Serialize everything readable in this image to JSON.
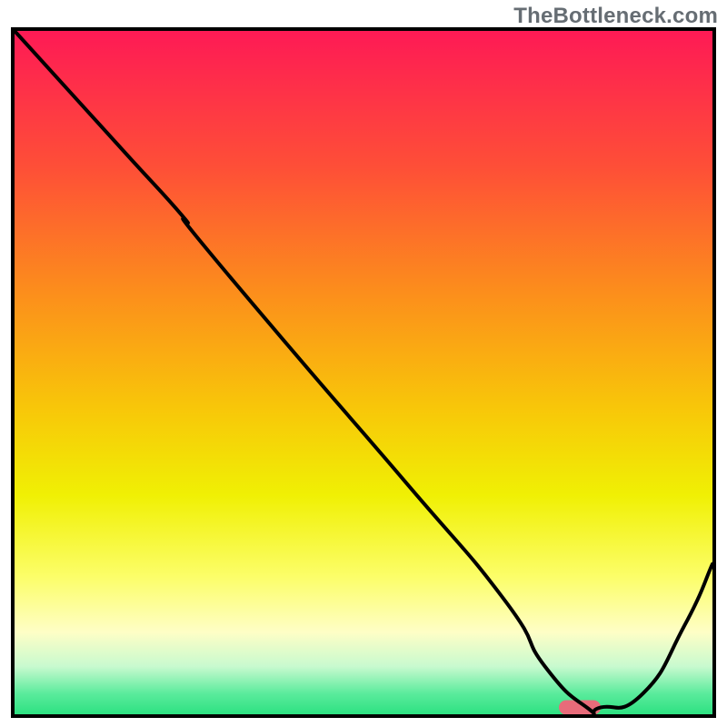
{
  "watermark": "TheBottleneck.com",
  "chart_data": {
    "type": "line",
    "title": "",
    "subtitle": "",
    "xlabel": "",
    "ylabel": "",
    "xlim": [
      0,
      100
    ],
    "ylim": [
      0,
      100
    ],
    "grid": false,
    "legend": false,
    "x": [
      0,
      8,
      16,
      24,
      26,
      40,
      56,
      70,
      76,
      82,
      84,
      90,
      96,
      100
    ],
    "values": [
      100,
      91,
      82,
      73,
      70,
      53,
      34,
      17,
      7,
      1,
      1,
      3,
      13,
      22
    ],
    "marker": {
      "shape": "rounded-bar",
      "x_start": 78,
      "x_end": 84,
      "y": 1,
      "color": "#e86b7a"
    },
    "background_gradient": {
      "stops": [
        {
          "pct": 0,
          "color": "#fe1a55"
        },
        {
          "pct": 20,
          "color": "#fe4f37"
        },
        {
          "pct": 38,
          "color": "#fc8d1c"
        },
        {
          "pct": 55,
          "color": "#f8c609"
        },
        {
          "pct": 68,
          "color": "#f0f004"
        },
        {
          "pct": 80,
          "color": "#fcfe6a"
        },
        {
          "pct": 88,
          "color": "#fefec6"
        },
        {
          "pct": 93,
          "color": "#c8facf"
        },
        {
          "pct": 97,
          "color": "#5aeb9c"
        },
        {
          "pct": 100,
          "color": "#2de181"
        }
      ]
    }
  }
}
